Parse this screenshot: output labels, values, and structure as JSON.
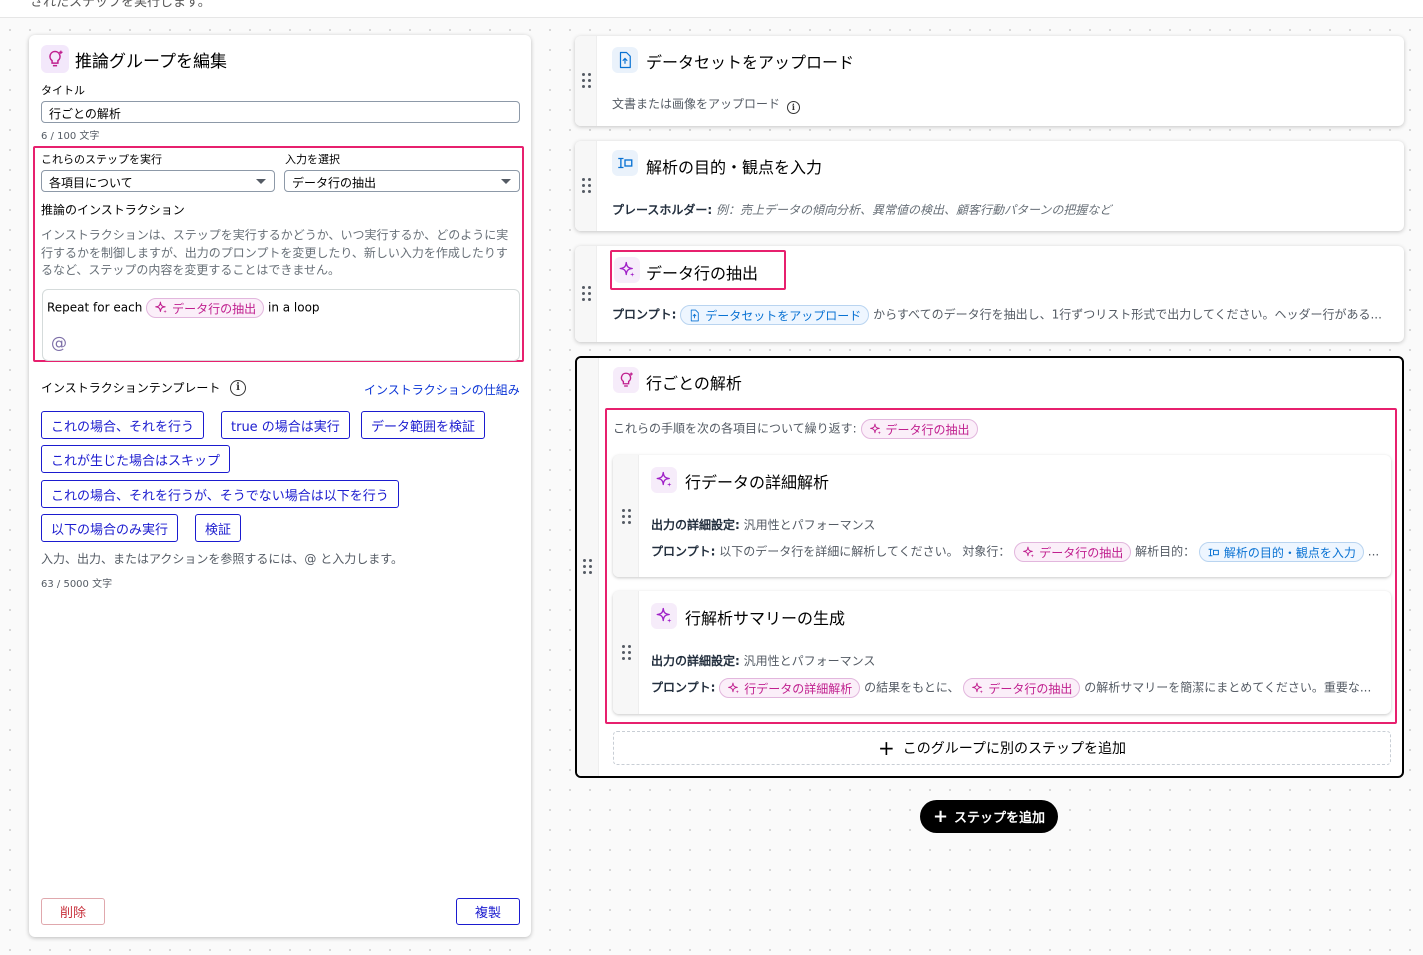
{
  "top_text": "されたステップを実行します。",
  "editor_panel": {
    "title": "推論グループを編集",
    "title_label": "タイトル",
    "title_value": "行ごとの解析",
    "title_count": "6 / 100 文字",
    "run_steps_label": "これらのステップを実行",
    "run_steps_value": "各項目について",
    "input_label": "入力を選択",
    "input_value": "データ行の抽出",
    "instruction_heading": "推論のインストラクション",
    "instruction_desc": "インストラクションは、ステップを実行するかどうか、いつ実行するか、どのように実行するかを制御しますが、出力のプロンプトを変更したり、新しい入力を作成したりするなど、ステップの内容を変更することはできません。",
    "editor_prefix": "Repeat for each",
    "editor_chip": "データ行の抽出",
    "editor_suffix": "in a loop",
    "at_symbol": "@",
    "templates_heading": "インストラクションテンプレート",
    "templates_link": "インストラクションの仕組み",
    "templates": [
      "これの場合、それを行う",
      "true の場合は実行",
      "データ範囲を検証",
      "これが生じた場合はスキップ",
      "これの場合、それを行うが、そうでない場合は以下を行う",
      "以下の場合のみ実行",
      "検証"
    ],
    "reference_hint": "入力、出力、またはアクションを参照するには、@ と入力します。",
    "instruction_count": "63 / 5000 文字",
    "delete_label": "削除",
    "duplicate_label": "複製"
  },
  "steps": {
    "upload": {
      "title": "データセットをアップロード",
      "meta": "文書または画像をアップロード"
    },
    "purpose": {
      "title": "解析の目的・観点を入力",
      "meta_label": "プレースホルダー:",
      "meta_value": "例：売上データの傾向分析、異常値の検出、顧客行動パターンの把握など"
    },
    "extract": {
      "title": "データ行の抽出",
      "prompt_label": "プロンプト:",
      "prompt_chip": "データセットをアップロード",
      "prompt_rest": "からすべてのデータ行を抽出し、1行ずつリスト形式で出力してください。ヘッダー行がある..."
    },
    "group": {
      "title": "行ごとの解析",
      "loop_text": "これらの手順を次の各項目について繰り返す:",
      "loop_chip": "データ行の抽出",
      "inner1": {
        "title": "行データの詳細解析",
        "detail_label": "出力の詳細設定:",
        "detail_value": "汎用性とパフォーマンス",
        "prompt_label": "プロンプト:",
        "prompt_text1": "以下のデータ行を詳細に解析してください。 対象行：",
        "prompt_chip1": "データ行の抽出",
        "prompt_text2": "解析目的：",
        "prompt_chip2": "解析の目的・観点を入力",
        "prompt_ellipsis": "..."
      },
      "inner2": {
        "title": "行解析サマリーの生成",
        "detail_label": "出力の詳細設定:",
        "detail_value": "汎用性とパフォーマンス",
        "prompt_label": "プロンプト:",
        "prompt_chip1": "行データの詳細解析",
        "prompt_text1": "の結果をもとに、",
        "prompt_chip2": "データ行の抽出",
        "prompt_text2": "の解析サマリーを簡潔にまとめてください。重要な..."
      },
      "add_label": "このグループに別のステップを追加"
    }
  },
  "add_step_label": "ステップを追加",
  "colors": {
    "accent_pink": "#e7206e",
    "primary_blue": "#1b1bcf",
    "chip_pink": "#c0208f",
    "chip_blue": "#0972d3"
  }
}
